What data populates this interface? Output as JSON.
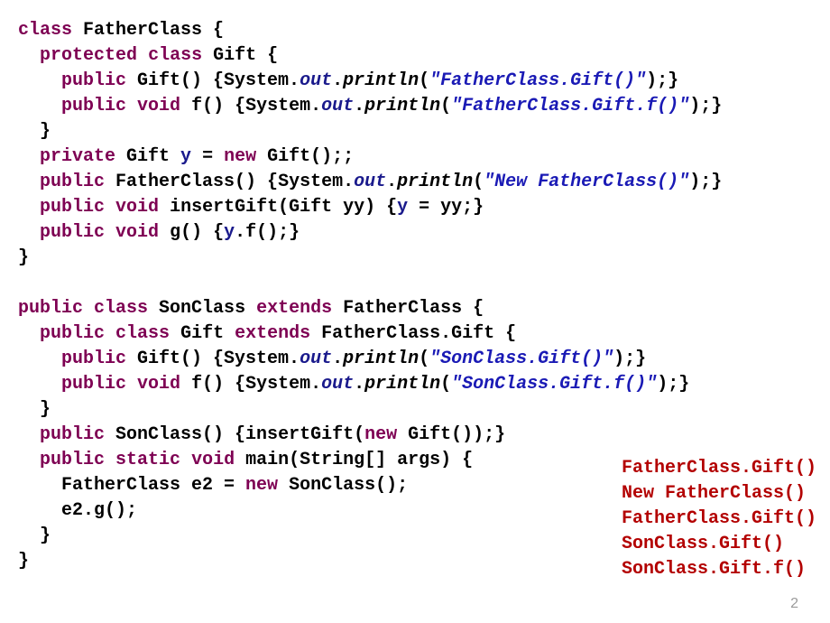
{
  "code": {
    "l1_kw1": "class",
    "l1_t1": " FatherClass {",
    "l2_kw1": "protected",
    "l2_kw2": "class",
    "l2_t1": " Gift {",
    "l3_kw1": "public",
    "l3_t1": " Gift() {System.",
    "l3_f1": "out",
    "l3_t2": ".",
    "l3_m1": "println",
    "l3_t3": "(",
    "l3_s1": "\"FatherClass.Gift()\"",
    "l3_t4": ");}",
    "l4_kw1": "public",
    "l4_kw2": "void",
    "l4_t1": " f() {System.",
    "l4_f1": "out",
    "l4_t2": ".",
    "l4_m1": "println",
    "l4_t3": "(",
    "l4_s1": "\"FatherClass.Gift.f()\"",
    "l4_t4": ");}",
    "l5_t1": "  }",
    "l6_kw1": "private",
    "l6_t1": " Gift ",
    "l6_f1": "y",
    "l6_t2": " = ",
    "l6_kw2": "new",
    "l6_t3": " Gift();;",
    "l7_kw1": "public",
    "l7_t1": " FatherClass() {System.",
    "l7_f1": "out",
    "l7_t2": ".",
    "l7_m1": "println",
    "l7_t3": "(",
    "l7_s1": "\"New FatherClass()\"",
    "l7_t4": ");}",
    "l8_kw1": "public",
    "l8_kw2": "void",
    "l8_t1": " insertGift(Gift yy) {",
    "l8_f1": "y",
    "l8_t2": " = yy;}",
    "l9_kw1": "public",
    "l9_kw2": "void",
    "l9_t1": " g() {",
    "l9_f1": "y",
    "l9_t2": ".f();}",
    "l10_t1": "}",
    "l12_kw1": "public",
    "l12_kw2": "class",
    "l12_t1": " SonClass ",
    "l12_kw3": "extends",
    "l12_t2": " FatherClass {",
    "l13_kw1": "public",
    "l13_kw2": "class",
    "l13_t1": " Gift ",
    "l13_kw3": "extends",
    "l13_t2": " FatherClass.Gift {",
    "l14_kw1": "public",
    "l14_t1": " Gift() {System.",
    "l14_f1": "out",
    "l14_t2": ".",
    "l14_m1": "println",
    "l14_t3": "(",
    "l14_s1": "\"SonClass.Gift()\"",
    "l14_t4": ");}",
    "l15_kw1": "public",
    "l15_kw2": "void",
    "l15_t1": " f() {System.",
    "l15_f1": "out",
    "l15_t2": ".",
    "l15_m1": "println",
    "l15_t3": "(",
    "l15_s1": "\"SonClass.Gift.f()\"",
    "l15_t4": ");}",
    "l16_t1": "  }",
    "l17_kw1": "public",
    "l17_t1": " SonClass() {insertGift(",
    "l17_kw2": "new",
    "l17_t2": " Gift());}",
    "l18_kw1": "public",
    "l18_kw2": "static",
    "l18_kw3": "void",
    "l18_t1": " main(String[] args) {",
    "l19_t1": "    FatherClass e2 = ",
    "l19_kw1": "new",
    "l19_t2": " SonClass();",
    "l20_t1": "    e2.g();",
    "l21_t1": "  }",
    "l22_t1": "}"
  },
  "output": {
    "line1": "FatherClass.Gift()",
    "line2": "New FatherClass()",
    "line3": "FatherClass.Gift()",
    "line4": "SonClass.Gift()",
    "line5": "SonClass.Gift.f()"
  },
  "page_number": "2"
}
